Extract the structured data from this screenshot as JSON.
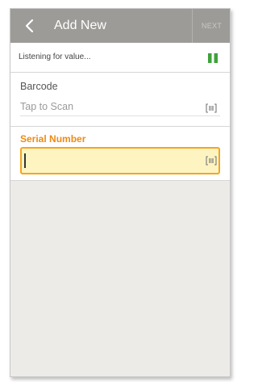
{
  "header": {
    "title": "Add New",
    "next_label": "NEXT",
    "back_icon": "chevron-left-icon"
  },
  "listening": {
    "text": "Listening for value...",
    "status_icon": "pause-icon",
    "status_color": "#3ea33a"
  },
  "barcode": {
    "label": "Barcode",
    "placeholder": "Tap to Scan",
    "value": "",
    "scan_icon": "barcode-scan-icon"
  },
  "serial_number": {
    "label": "Serial Number",
    "value": "",
    "scan_icon": "barcode-scan-icon"
  },
  "colors": {
    "appbar": "#9c9b98",
    "accent_orange": "#f08a12",
    "focus_fill": "#fef4c1",
    "background": "#ecebe8"
  }
}
